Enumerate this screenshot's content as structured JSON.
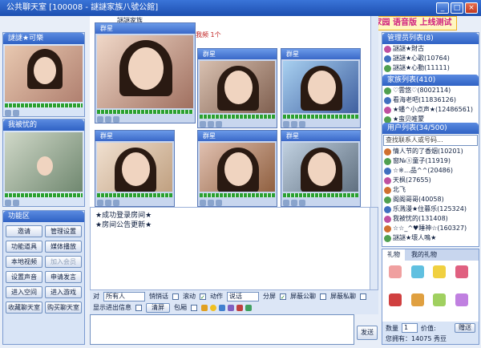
{
  "window": {
    "title": "公共聊天室 [100008 - 謎謎家族八號公館]"
  },
  "banner": "聊秀家园 语音版 上线测试",
  "left": {
    "cam1_label": "謎謎★可樂",
    "cam2_label": "我被忧的",
    "func_title": "功能区",
    "buttons": [
      "邀请",
      "管理设置",
      "功能道具",
      "媒体播放",
      "本地视频",
      "加入会员",
      "设置声音",
      "申请发言",
      "进入空间",
      "进入游戏",
      "收藏聊天室",
      "购买聊天室"
    ]
  },
  "videos": {
    "label": "群星",
    "room_text": "謎謎家族",
    "notice_right": "我频  1个"
  },
  "chat": {
    "lines": [
      "★成功登录房间★",
      "★房间公告更新★"
    ]
  },
  "chat_prefix": "[謎謎★",
  "right": {
    "managers_title": "管理员列表(8)",
    "managers": [
      "謎謎★財古",
      "謎謎★心歌(10764)",
      "謎謎★心動(11111)"
    ],
    "family_title": "家族列表(410)",
    "family": [
      "♡雲悠♡(8002114)",
      "看海老吧(11836126)",
      "★蟠^小点声★(12486561)",
      "★蛮贝唯蒙"
    ],
    "users_title": "用户列表(34/500)",
    "search_placeholder": "查找联系人或号码...",
    "users": [
      "情人节的了香烟(10201)",
      "窗№ⓢ童子(11919)",
      "☆※…品^^(20486)",
      "天枫(27655)",
      "北飞",
      "阁阁哥哥(40058)",
      "乐溅漫★住暮乐(125324)",
      "我被忧的(131408)",
      "☆☆_^♥睡神☆(160327)",
      "謎謎★壞人鳴★"
    ]
  },
  "gifts": {
    "tab1": "礼物",
    "tab2": "我的礼物",
    "qty_label": "数量",
    "qty_value": "1",
    "price_label": "价值:",
    "send": "赠送",
    "owned": "您拥有：14075 秀豆"
  },
  "input": {
    "to_label": "对",
    "to_value": "所有人",
    "whisper": "悄悄话",
    "scroll": "滚动",
    "action_label": "动作",
    "action_value": "说话",
    "split": "分屏",
    "block_public": "屏蔽公聊",
    "block_private": "屏蔽私聊",
    "show_enter": "显示进出信息",
    "clear": "清屏",
    "enclose": "包厢",
    "send": "发送"
  },
  "colors": {
    "title": "#1d4fb0",
    "accent": "#3a68c8"
  }
}
